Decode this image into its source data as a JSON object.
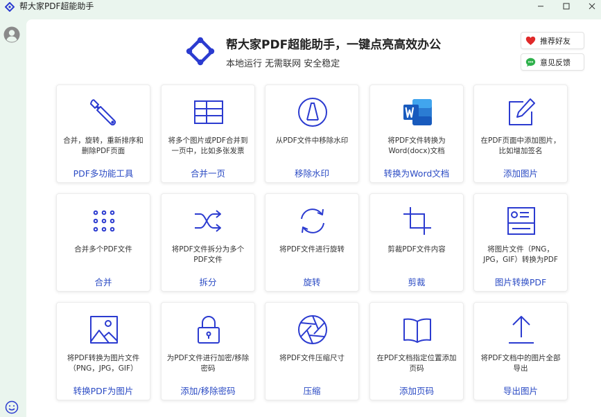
{
  "app": {
    "title": "帮大家PDF超能助手"
  },
  "window": {
    "minimize": "—",
    "maximize": "☐",
    "close": "✕"
  },
  "header": {
    "title": "帮大家PDF超能助手，一键点亮高效办公",
    "subtitle": "本地运行 无需联网 安全稳定",
    "recommend_label": "推荐好友",
    "feedback_label": "意见反馈"
  },
  "colors": {
    "accent": "#2b3bd0",
    "link": "#2b4bc4",
    "background": "#eaf5ee"
  },
  "tools": [
    {
      "icon": "wrench-icon",
      "desc": "合并，旋转，重新排序和删除PDF页面",
      "name": "PDF多功能工具"
    },
    {
      "icon": "grid-table-icon",
      "desc": "将多个图片或PDF合并到一页中，比如多张发票",
      "name": "合并一页"
    },
    {
      "icon": "watermark-icon",
      "desc": "从PDF文件中移除水印",
      "name": "移除水印"
    },
    {
      "icon": "word-icon",
      "desc": "将PDF文件转换为Word(docx)文档",
      "name": "转换为Word文档"
    },
    {
      "icon": "edit-icon",
      "desc": "在PDF页面中添加图片，比如增加签名",
      "name": "添加图片"
    },
    {
      "icon": "dots-grid-icon",
      "desc": "合并多个PDF文件",
      "name": "合并"
    },
    {
      "icon": "shuffle-icon",
      "desc": "将PDF文件拆分为多个PDF文件",
      "name": "拆分"
    },
    {
      "icon": "rotate-icon",
      "desc": "将PDF文件进行旋转",
      "name": "旋转"
    },
    {
      "icon": "crop-icon",
      "desc": "剪裁PDF文件内容",
      "name": "剪裁"
    },
    {
      "icon": "image-to-pdf-icon",
      "desc": "将图片文件（PNG，JPG，GIF）转换为PDF",
      "name": "图片转换PDF"
    },
    {
      "icon": "image-icon",
      "desc": "将PDF转换为图片文件（PNG，JPG，GIF）",
      "name": "转换PDF为图片"
    },
    {
      "icon": "lock-icon",
      "desc": "为PDF文件进行加密/移除密码",
      "name": "添加/移除密码"
    },
    {
      "icon": "aperture-icon",
      "desc": "将PDF文件压缩尺寸",
      "name": "压缩"
    },
    {
      "icon": "book-icon",
      "desc": "在PDF文档指定位置添加页码",
      "name": "添加页码"
    },
    {
      "icon": "export-icon",
      "desc": "将PDF文档中的图片全部导出",
      "name": "导出图片"
    }
  ]
}
